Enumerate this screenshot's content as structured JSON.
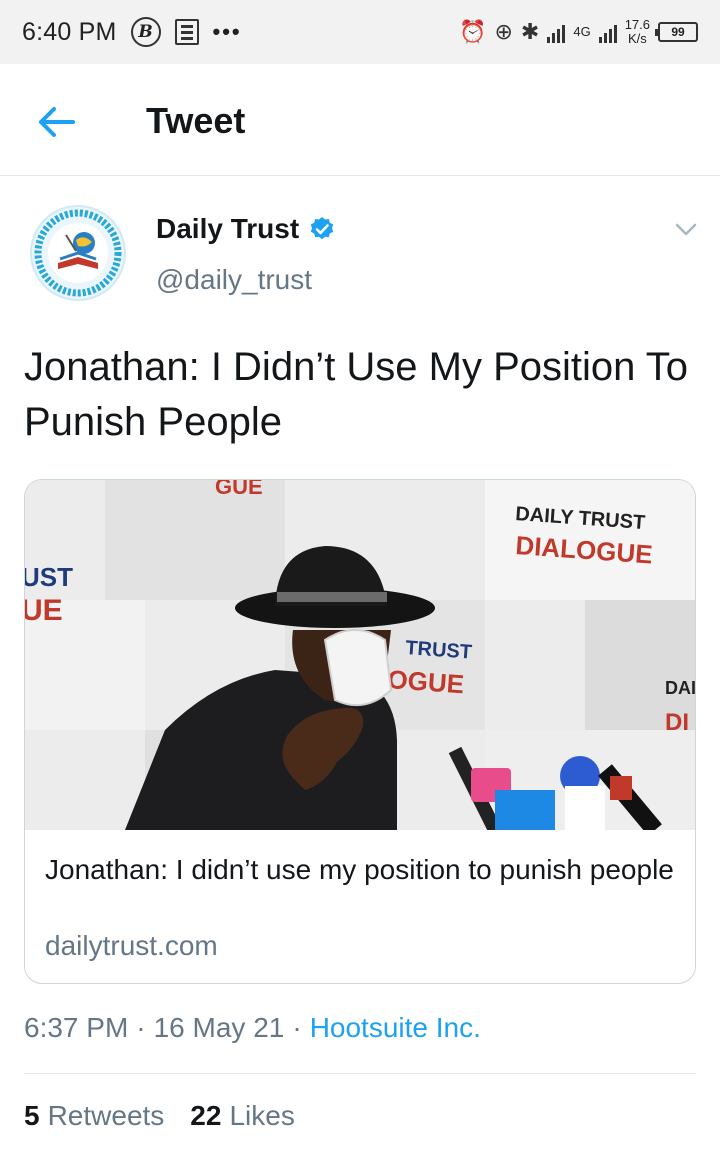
{
  "status_bar": {
    "time": "6:40 PM",
    "dots": "•••",
    "network": "4G",
    "speed_value": "17.6",
    "speed_unit": "K/s",
    "battery": "99"
  },
  "header": {
    "title": "Tweet",
    "back_icon": "arrow-left-icon"
  },
  "tweet": {
    "author_name": "Daily Trust",
    "author_handle": "@daily_trust",
    "verified": true,
    "text": "Jonathan: I Didn’t Use My Position To Punish People",
    "card": {
      "title": "Jonathan: I didn’t use my position to punish people",
      "domain": "dailytrust.com",
      "image_texts": {
        "brand_top": "DAILY TRUST",
        "dialogue": "DIALOGUE",
        "top_partial": "GUE",
        "left_partial_1": "UST",
        "left_partial_2": "UE",
        "mid_partial_1": "TRUST",
        "mid_partial_2": "OGUE",
        "right_partial_1": "DAI",
        "right_partial_2": "DI"
      }
    },
    "time": "6:37 PM",
    "separator": "·",
    "date": "16 May 21",
    "source": "Hootsuite Inc."
  },
  "stats": {
    "retweets_count": "5",
    "retweets_label": "Retweets",
    "likes_count": "22",
    "likes_label": "Likes"
  },
  "colors": {
    "accent": "#1da1f2",
    "secondary_text": "#657786",
    "primary_text": "#14171a"
  }
}
